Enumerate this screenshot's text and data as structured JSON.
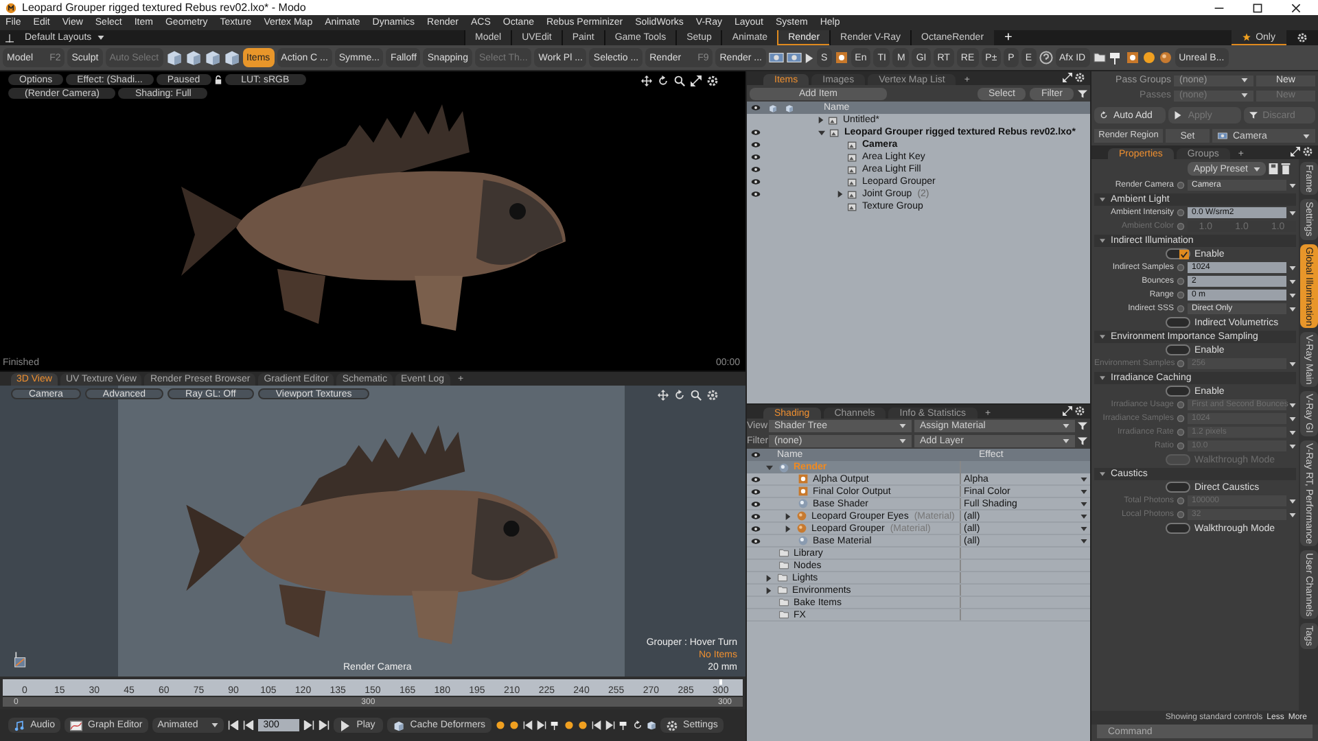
{
  "window": {
    "title": "Leopard Grouper rigged textured Rebus rev02.lxo* - Modo"
  },
  "menu": [
    "File",
    "Edit",
    "View",
    "Select",
    "Item",
    "Geometry",
    "Texture",
    "Vertex Map",
    "Animate",
    "Dynamics",
    "Render",
    "ACS",
    "Octane",
    "Rebus Perminizer",
    "SolidWorks",
    "V-Ray",
    "Layout",
    "System",
    "Help"
  ],
  "layouts": {
    "dropdown": "Default Layouts",
    "tabs": [
      {
        "label": "Model",
        "selected": false
      },
      {
        "label": "UVEdit",
        "selected": false
      },
      {
        "label": "Paint",
        "selected": false
      },
      {
        "label": "Game Tools",
        "selected": false
      },
      {
        "label": "Setup",
        "selected": false
      },
      {
        "label": "Animate",
        "selected": false
      },
      {
        "label": "Render",
        "selected": true
      },
      {
        "label": "Render V-Ray",
        "selected": false
      },
      {
        "label": "OctaneRender",
        "selected": false
      }
    ],
    "add": "+",
    "only": "Only"
  },
  "toolbar": [
    {
      "buttons": [
        {
          "label": "Model",
          "shortcut": "F2",
          "selected": false,
          "disabled": false
        },
        {
          "label": "Sculpt",
          "selected": false,
          "disabled": false
        }
      ]
    },
    {
      "buttons": [
        {
          "label": "Auto Select",
          "selected": false,
          "disabled": true
        }
      ]
    },
    {
      "buttons": [
        {
          "label": "Items",
          "selected": true,
          "disabled": false
        },
        {
          "label": "Action C ...",
          "selected": false,
          "disabled": false
        },
        {
          "label": "Symme...",
          "selected": false,
          "disabled": false
        },
        {
          "label": "Falloff",
          "selected": false,
          "disabled": false
        },
        {
          "label": "Snapping",
          "selected": false,
          "disabled": false
        },
        {
          "label": "Select Th...",
          "selected": false,
          "disabled": true
        },
        {
          "label": "Work Pl ...",
          "selected": false,
          "disabled": false
        },
        {
          "label": "Selectio ...",
          "selected": false,
          "disabled": false
        },
        {
          "label": "Render",
          "shortcut": "F9",
          "selected": false,
          "disabled": false
        },
        {
          "label": "Render ...",
          "selected": false,
          "disabled": false
        }
      ]
    },
    {
      "buttons": [
        {
          "label": "S",
          "selected": false,
          "disabled": false
        }
      ]
    },
    {
      "buttons": [
        {
          "label": "En",
          "selected": false,
          "disabled": false
        },
        {
          "label": "TI",
          "selected": false,
          "disabled": false
        },
        {
          "label": "M",
          "selected": false,
          "disabled": false
        },
        {
          "label": "GI",
          "selected": false,
          "disabled": false
        },
        {
          "label": "RT",
          "selected": false,
          "disabled": false
        },
        {
          "label": "RE",
          "selected": false,
          "disabled": false
        },
        {
          "label": "P±",
          "selected": false,
          "disabled": false
        },
        {
          "label": "P",
          "selected": false,
          "disabled": false
        },
        {
          "label": "E",
          "selected": false,
          "disabled": false
        }
      ]
    },
    {
      "buttons": [
        {
          "label": "Afx ID",
          "selected": false,
          "disabled": false
        }
      ]
    },
    {
      "buttons": [
        {
          "label": "Unreal B...",
          "selected": false,
          "disabled": false
        }
      ]
    }
  ],
  "render_view": {
    "buttons_row1": [
      "Options",
      "Effect: (Shadi...",
      "Paused"
    ],
    "lut": "LUT: sRGB",
    "buttons_row2": [
      "(Render Camera)",
      "Shading: Full"
    ],
    "status": "Finished",
    "time": "00:00"
  },
  "view_panel": {
    "tabs": [
      {
        "label": "3D View",
        "selected": true
      },
      {
        "label": "UV Texture View",
        "selected": false
      },
      {
        "label": "Render Preset Browser",
        "selected": false
      },
      {
        "label": "Gradient Editor",
        "selected": false
      },
      {
        "label": "Schematic",
        "selected": false
      },
      {
        "label": "Event Log",
        "selected": false
      }
    ],
    "add": "+",
    "buttons": [
      "Camera",
      "Advanced",
      "Ray GL: Off",
      "Viewport Textures"
    ],
    "camera_label": "Render Camera",
    "info": [
      "Grouper : Hover Turn",
      "No Items",
      "20 mm"
    ]
  },
  "timeline": {
    "ticks": [
      "0",
      "15",
      "30",
      "45",
      "60",
      "75",
      "90",
      "105",
      "120",
      "135",
      "150",
      "165",
      "180",
      "195",
      "210",
      "225",
      "240",
      "255",
      "270",
      "285",
      "300"
    ],
    "range_start": "0",
    "range_middle": "300",
    "range_end": "300",
    "level": 1
  },
  "transport": {
    "audio": "Audio",
    "graph_editor": "Graph Editor",
    "mode": "Animated",
    "frame": "300",
    "play": "Play",
    "cache": "Cache Deformers",
    "settings": "Settings"
  },
  "items_panel": {
    "tabs": [
      {
        "label": "Items",
        "selected": true
      },
      {
        "label": "Images",
        "selected": false
      },
      {
        "label": "Vertex Map List",
        "selected": false
      }
    ],
    "add": "+",
    "add_item": "Add Item",
    "select": "Select",
    "filter": "Filter",
    "column": "Name",
    "tree": [
      {
        "label": "Untitled*",
        "bold": false,
        "visible": false,
        "expanded": false
      },
      {
        "label": "Leopard Grouper rigged textured Rebus rev02.lxo*",
        "bold": true,
        "visible": true,
        "expanded": true,
        "children": [
          {
            "label": "Camera",
            "bold": true,
            "visible": true
          },
          {
            "label": "Area Light Key",
            "bold": false,
            "visible": true
          },
          {
            "label": "Area Light Fill",
            "bold": false,
            "visible": true
          },
          {
            "label": "Leopard Grouper",
            "bold": false,
            "visible": true
          },
          {
            "label": "Joint Group",
            "count": "(2)",
            "bold": false,
            "visible": true,
            "expanded": false
          },
          {
            "label": "Texture Group",
            "bold": false,
            "visible": false
          }
        ]
      }
    ]
  },
  "shading_panel": {
    "tabs": [
      {
        "label": "Shading",
        "selected": true
      },
      {
        "label": "Channels",
        "selected": false
      },
      {
        "label": "Info & Statistics",
        "selected": false
      }
    ],
    "add": "+",
    "view_label": "View",
    "view": "Shader Tree",
    "assign": "Assign Material",
    "filter_label": "Filter",
    "filter": "(none)",
    "add_layer": "Add Layer",
    "columns": [
      "Name",
      "Effect"
    ],
    "tree": [
      {
        "label": "Render",
        "selected": true,
        "expanded": true,
        "children": [
          {
            "label": "Alpha Output",
            "effect": "Alpha",
            "visible": true,
            "selected": false
          },
          {
            "label": "Final Color Output",
            "effect": "Final Color",
            "visible": true,
            "selected": false
          },
          {
            "label": "Base Shader",
            "effect": "Full Shading",
            "visible": true,
            "selected": false
          },
          {
            "label": "Leopard Grouper Eyes",
            "tag": "(Material)",
            "effect": "(all)",
            "visible": true,
            "selected": false,
            "expanded": false
          },
          {
            "label": "Leopard Grouper",
            "tag": "(Material)",
            "effect": "(all)",
            "visible": true,
            "selected": false,
            "expanded": false
          },
          {
            "label": "Base Material",
            "effect": "(all)",
            "visible": true,
            "selected": false
          }
        ]
      },
      {
        "label": "Library",
        "selected": false
      },
      {
        "label": "Nodes",
        "selected": false
      },
      {
        "label": "Lights",
        "selected": false,
        "expanded": false
      },
      {
        "label": "Environments",
        "selected": false,
        "expanded": false
      },
      {
        "label": "Bake Items",
        "selected": false
      },
      {
        "label": "FX",
        "selected": false
      }
    ]
  },
  "passes": [
    {
      "label": "Pass Groups",
      "value": "(none)",
      "button": "New",
      "disabled": false
    },
    {
      "label": "Passes",
      "value": "(none)",
      "button": "New",
      "disabled": true
    }
  ],
  "pass_actions": [
    {
      "label": "Auto Add",
      "disabled": false
    },
    {
      "label": "Apply",
      "disabled": true
    },
    {
      "label": "Discard",
      "disabled": true
    }
  ],
  "render_region": {
    "label": "Render Region",
    "set": "Set",
    "camera": "Camera"
  },
  "properties": {
    "tabs": [
      {
        "label": "Properties",
        "selected": true
      },
      {
        "label": "Groups",
        "selected": false
      }
    ],
    "add": "+",
    "apply_preset": "Apply Preset",
    "rows": [
      {
        "kind": "dropdown",
        "label": "Render Camera",
        "value": "Camera",
        "disabled": false
      },
      {
        "kind": "section",
        "label": "Ambient Light"
      },
      {
        "kind": "field",
        "label": "Ambient Intensity",
        "value": "0.0 W/srm2",
        "disabled": false
      },
      {
        "kind": "color",
        "label": "Ambient Color",
        "values": [
          "1.0",
          "1.0",
          "1.0"
        ],
        "disabled": true
      },
      {
        "kind": "section",
        "label": "Indirect Illumination"
      },
      {
        "kind": "checkbox",
        "label": "Enable",
        "checked": true,
        "disabled": false
      },
      {
        "kind": "field",
        "label": "Indirect Samples",
        "value": "1024",
        "disabled": false
      },
      {
        "kind": "field",
        "label": "Bounces",
        "value": "2",
        "disabled": false
      },
      {
        "kind": "field",
        "label": "Range",
        "value": "0 m",
        "disabled": false
      },
      {
        "kind": "dropdown",
        "label": "Indirect SSS",
        "value": "Direct Only",
        "disabled": false
      },
      {
        "kind": "checkbox",
        "label": "Indirect Volumetrics",
        "checked": false,
        "disabled": false
      },
      {
        "kind": "section",
        "label": "Environment Importance Sampling"
      },
      {
        "kind": "checkbox",
        "label": "Enable",
        "checked": false,
        "disabled": false
      },
      {
        "kind": "field",
        "label": "Environment Samples",
        "value": "256",
        "disabled": true
      },
      {
        "kind": "section",
        "label": "Irradiance Caching"
      },
      {
        "kind": "checkbox",
        "label": "Enable",
        "checked": false,
        "disabled": false
      },
      {
        "kind": "dropdown",
        "label": "Irradiance Usage",
        "value": "First and Second Bounces",
        "disabled": true
      },
      {
        "kind": "field",
        "label": "Irradiance Samples",
        "value": "1024",
        "disabled": true
      },
      {
        "kind": "field",
        "label": "Irradiance Rate",
        "value": "1.2 pixels",
        "disabled": true
      },
      {
        "kind": "field",
        "label": "Ratio",
        "value": "10.0",
        "disabled": true
      },
      {
        "kind": "checkbox",
        "label": "Walkthrough Mode",
        "checked": false,
        "disabled": true
      },
      {
        "kind": "section",
        "label": "Caustics"
      },
      {
        "kind": "checkbox",
        "label": "Direct Caustics",
        "checked": false,
        "disabled": false
      },
      {
        "kind": "field",
        "label": "Total Photons",
        "value": "100000",
        "disabled": true
      },
      {
        "kind": "field",
        "label": "Local Photons",
        "value": "32",
        "disabled": true
      },
      {
        "kind": "checkbox",
        "label": "Walkthrough Mode",
        "checked": false,
        "disabled": false
      }
    ]
  },
  "side_tabs": [
    {
      "label": "Frame",
      "selected": false
    },
    {
      "label": "Settings",
      "selected": false
    },
    {
      "label": "Global Illumination",
      "selected": true
    },
    {
      "label": "V-Ray Main",
      "selected": false
    },
    {
      "label": "V-Ray GI",
      "selected": false
    },
    {
      "label": "V-Ray RT, Performance",
      "selected": false
    },
    {
      "label": "User Channels",
      "selected": false
    },
    {
      "label": "Tags",
      "selected": false
    }
  ],
  "footer": {
    "text": "Showing standard controls",
    "less": "Less",
    "more": "More",
    "command_placeholder": "Command"
  }
}
